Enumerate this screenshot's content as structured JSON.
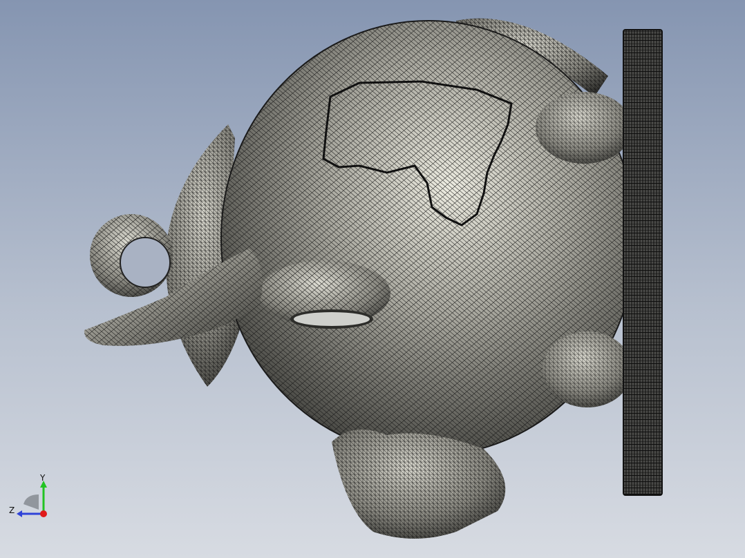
{
  "viewport": {
    "model_name": "piggy-bank-mesh",
    "background_top": "#8595b1",
    "background_bottom": "#d7dbe2",
    "mesh_color": "#141414",
    "shade_light": "#e3e2d8",
    "shade_dark": "#2e2e2b"
  },
  "triad": {
    "y_label": "Y",
    "z_label": "Z",
    "y_color": "#22c322",
    "z_color": "#2f43d8",
    "x_color": "#e01a1a"
  }
}
